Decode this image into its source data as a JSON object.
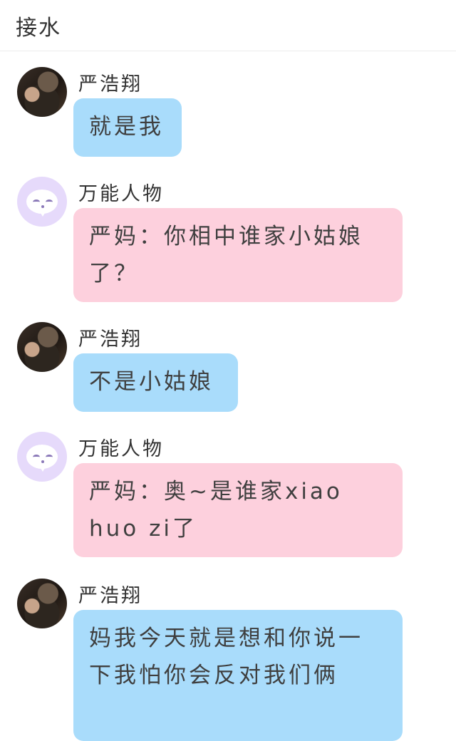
{
  "header": {
    "title": "接水"
  },
  "messages": [
    {
      "sender": "严浩翔",
      "avatar": "photo",
      "text": "就是我",
      "color": "#a9dcfb"
    },
    {
      "sender": "万能人物",
      "avatar": "bot",
      "text": "严妈：你相中谁家小姑娘了？",
      "color": "#fdd0dd"
    },
    {
      "sender": "严浩翔",
      "avatar": "photo",
      "text": "不是小姑娘",
      "color": "#a9dcfb"
    },
    {
      "sender": "万能人物",
      "avatar": "bot",
      "text": "严妈：奥~是谁家xiao huo zi了",
      "color": "#fdd0dd"
    },
    {
      "sender": "严浩翔",
      "avatar": "photo",
      "text": "妈我今天就是想和你说一下我怕你会反对我们俩",
      "color": "#a9dcfb"
    }
  ]
}
